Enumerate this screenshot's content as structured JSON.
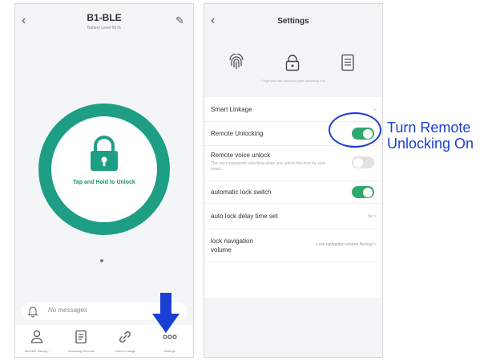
{
  "colors": {
    "brand_green": "#1e9e85",
    "toggle_on": "#2ea86d",
    "toggle_off": "#e2e2e2",
    "annotation_blue": "#1a3fd3"
  },
  "lock_screen": {
    "title": "B1-BLE",
    "subtitle": "Battery Level 99 %",
    "unlock_prompt": "Tap and Hold to Unlock",
    "message_placeholder": "No messages",
    "tabs": [
      {
        "label": "Member Manag...",
        "icon": "person-icon"
      },
      {
        "label": "Unlocking Records",
        "icon": "records-icon"
      },
      {
        "label": "Users Linkage",
        "icon": "link-icon"
      },
      {
        "label": "Settings",
        "icon": "more-icon"
      }
    ]
  },
  "settings_screen": {
    "title": "Settings",
    "top_icons_caption": "Fingerprint set  Unlocking type  Unlocking unit",
    "rows": [
      {
        "label": "Smart Linkage",
        "value": ">"
      },
      {
        "label": "Remote Unlocking",
        "toggle": "on"
      },
      {
        "label": "Remote voice unlock",
        "description": "The voice password unlocking when you unlock the door by your smart...",
        "toggle": "off"
      },
      {
        "label": "automatic lock switch",
        "toggle": "on"
      },
      {
        "label": "auto lock delay time set",
        "value": "5s >"
      },
      {
        "label": "lock navigation volume",
        "value": "Lock navigation volume Normal >"
      }
    ]
  },
  "annotation": {
    "callout": "Turn Remote Unlocking On",
    "callout_line1": "Turn Remote",
    "callout_line2": "Unlocking On"
  }
}
